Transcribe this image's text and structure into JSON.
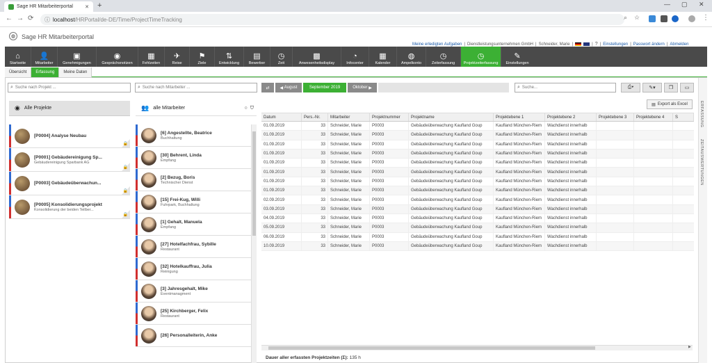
{
  "browser": {
    "tab_title": "Sage HR Mitarbeiterportal",
    "url_host": "localhost",
    "url_path": "/HRPortal/de-DE/Time/ProjectTimeTracking"
  },
  "app": {
    "title": "Sage HR Mitarbeiterportal"
  },
  "toplinks": {
    "tasks": "Meine erledigten Aufgaben",
    "company": "Dienstleistungsunternehmen GmbH",
    "user": "Schneider, Marie",
    "settings": "Einstellungen",
    "password": "Passwort ändern",
    "logout": "Abmelden"
  },
  "menu": [
    {
      "label": "Startseite",
      "icon": "⌂"
    },
    {
      "label": "Mitarbeiter",
      "icon": "👤"
    },
    {
      "label": "Genehmigungen",
      "icon": "▣"
    },
    {
      "label": "Gesprächsnotizen",
      "icon": "◉"
    },
    {
      "label": "Fehlzeiten",
      "icon": "▦"
    },
    {
      "label": "Reise",
      "icon": "✈"
    },
    {
      "label": "Ziele",
      "icon": "⚑"
    },
    {
      "label": "Entwicklung",
      "icon": "⇅"
    },
    {
      "label": "Bewerber",
      "icon": "▤"
    },
    {
      "label": "Zeit",
      "icon": "◷"
    },
    {
      "label": "Anwesenheitsdisplay",
      "icon": "▩"
    },
    {
      "label": "Infocenter",
      "icon": "◔"
    },
    {
      "label": "Kalender",
      "icon": "▦"
    },
    {
      "label": "Ampelkonto",
      "icon": "◍"
    },
    {
      "label": "Zeiterfassung",
      "icon": "◷"
    },
    {
      "label": "Projektzeiterfassung",
      "icon": "◷"
    },
    {
      "label": "Einstellungen",
      "icon": "✎"
    }
  ],
  "subtabs": [
    "Übersicht",
    "Erfassung",
    "Meine Daten"
  ],
  "projects": {
    "search_placeholder": "Suche nach Projekt ...",
    "header": "Alle Projekte",
    "items": [
      {
        "title": "[P0004] Analyse Neubau",
        "sub": ""
      },
      {
        "title": "[P0001] Gebäudereinigung Sp...",
        "sub": "Gebäudereinigung Sparbank AG"
      },
      {
        "title": "[P0003] Gebäudeüberwachun...",
        "sub": ""
      },
      {
        "title": "[P0005] Konsolidierungsprojekt",
        "sub": "Konsolidierung der beiden Teilber..."
      }
    ]
  },
  "employees": {
    "search_placeholder": "Suche nach Mitarbeiter ...",
    "header": "alle Mitarbeiter",
    "items": [
      {
        "title": "[6] Angestellte, Beatrice",
        "sub": "Buchhaltung"
      },
      {
        "title": "[30] Behrent, Linda",
        "sub": "Empfang"
      },
      {
        "title": "[2] Bezug, Boris",
        "sub": "Technischer Dienst"
      },
      {
        "title": "[15] Frei-Kug, Willi",
        "sub": "Fuhrpark, Buchhaltung"
      },
      {
        "title": "[1] Gehalt, Manuela",
        "sub": "Empfang"
      },
      {
        "title": "[27] Hotelfachfrau, Sybille",
        "sub": "Restaurant"
      },
      {
        "title": "[32] Hotelkauffrau, Julia",
        "sub": "Reinigung"
      },
      {
        "title": "[3] Jahresgehalt, Mike",
        "sub": "Eventmanagment"
      },
      {
        "title": "[25] Kirchberger, Felix",
        "sub": "Restaurant"
      },
      {
        "title": "[26] Personalleiterin, Anke",
        "sub": ""
      }
    ]
  },
  "toolbar": {
    "prev_label": "August",
    "current_label": "September 2019",
    "next_label": "Oktober",
    "search_placeholder": "Suche...",
    "export_label": "Export als Excel"
  },
  "table": {
    "columns": [
      "Datum",
      "Pers.-Nr.",
      "Mitarbeiter",
      "Projektnummer",
      "Projektname",
      "Projektebene 1",
      "Projektebene 2",
      "Projektebene 3",
      "Projektebene 4",
      "S"
    ],
    "rows": [
      [
        "01.09.2019",
        "33",
        "Schneider, Marie",
        "P0003",
        "Gebäudeüberwachung Kaufland Goup",
        "Kaufland München-Riem",
        "Wachdienst innerhalb",
        "",
        ""
      ],
      [
        "01.09.2019",
        "33",
        "Schneider, Marie",
        "P0003",
        "Gebäudeüberwachung Kaufland Goup",
        "Kaufland München-Riem",
        "Wachdienst innerhalb",
        "",
        ""
      ],
      [
        "01.09.2019",
        "33",
        "Schneider, Marie",
        "P0003",
        "Gebäudeüberwachung Kaufland Goup",
        "Kaufland München-Riem",
        "Wachdienst innerhalb",
        "",
        ""
      ],
      [
        "01.09.2019",
        "33",
        "Schneider, Marie",
        "P0003",
        "Gebäudeüberwachung Kaufland Goup",
        "Kaufland München-Riem",
        "Wachdienst innerhalb",
        "",
        ""
      ],
      [
        "01.09.2019",
        "33",
        "Schneider, Marie",
        "P0003",
        "Gebäudeüberwachung Kaufland Goup",
        "Kaufland München-Riem",
        "Wachdienst innerhalb",
        "",
        ""
      ],
      [
        "01.09.2019",
        "33",
        "Schneider, Marie",
        "P0003",
        "Gebäudeüberwachung Kaufland Goup",
        "Kaufland München-Riem",
        "Wachdienst innerhalb",
        "",
        ""
      ],
      [
        "01.09.2019",
        "33",
        "Schneider, Marie",
        "P0003",
        "Gebäudeüberwachung Kaufland Goup",
        "Kaufland München-Riem",
        "Wachdienst innerhalb",
        "",
        ""
      ],
      [
        "01.09.2019",
        "33",
        "Schneider, Marie",
        "P0003",
        "Gebäudeüberwachung Kaufland Goup",
        "Kaufland München-Riem",
        "Wachdienst innerhalb",
        "",
        ""
      ],
      [
        "02.09.2019",
        "33",
        "Schneider, Marie",
        "P0003",
        "Gebäudeüberwachung Kaufland Goup",
        "Kaufland München-Riem",
        "Wachdienst innerhalb",
        "",
        ""
      ],
      [
        "03.09.2019",
        "33",
        "Schneider, Marie",
        "P0003",
        "Gebäudeüberwachung Kaufland Goup",
        "Kaufland München-Riem",
        "Wachdienst innerhalb",
        "",
        ""
      ],
      [
        "04.09.2019",
        "33",
        "Schneider, Marie",
        "P0003",
        "Gebäudeüberwachung Kaufland Goup",
        "Kaufland München-Riem",
        "Wachdienst innerhalb",
        "",
        ""
      ],
      [
        "05.09.2019",
        "33",
        "Schneider, Marie",
        "P0003",
        "Gebäudeüberwachung Kaufland Goup",
        "Kaufland München-Riem",
        "Wachdienst innerhalb",
        "",
        ""
      ],
      [
        "06.09.2019",
        "33",
        "Schneider, Marie",
        "P0003",
        "Gebäudeüberwachung Kaufland Goup",
        "Kaufland München-Riem",
        "Wachdienst innerhalb",
        "",
        ""
      ],
      [
        "10.09.2019",
        "33",
        "Schneider, Marie",
        "P0003",
        "Gebäudeüberwachung Kaufland Goup",
        "Kaufland München-Riem",
        "Wachdienst innerhalb",
        "",
        ""
      ]
    ]
  },
  "side_tabs": [
    "ERFASSUNG",
    "ZEITAUSWERTUNGEN"
  ],
  "footer": {
    "label": "Dauer aller erfassten Projektzeiten (Σ):",
    "value": "135 h"
  },
  "colors": {
    "accent": "#3cb034",
    "menu_bg": "#4a4a4a"
  }
}
